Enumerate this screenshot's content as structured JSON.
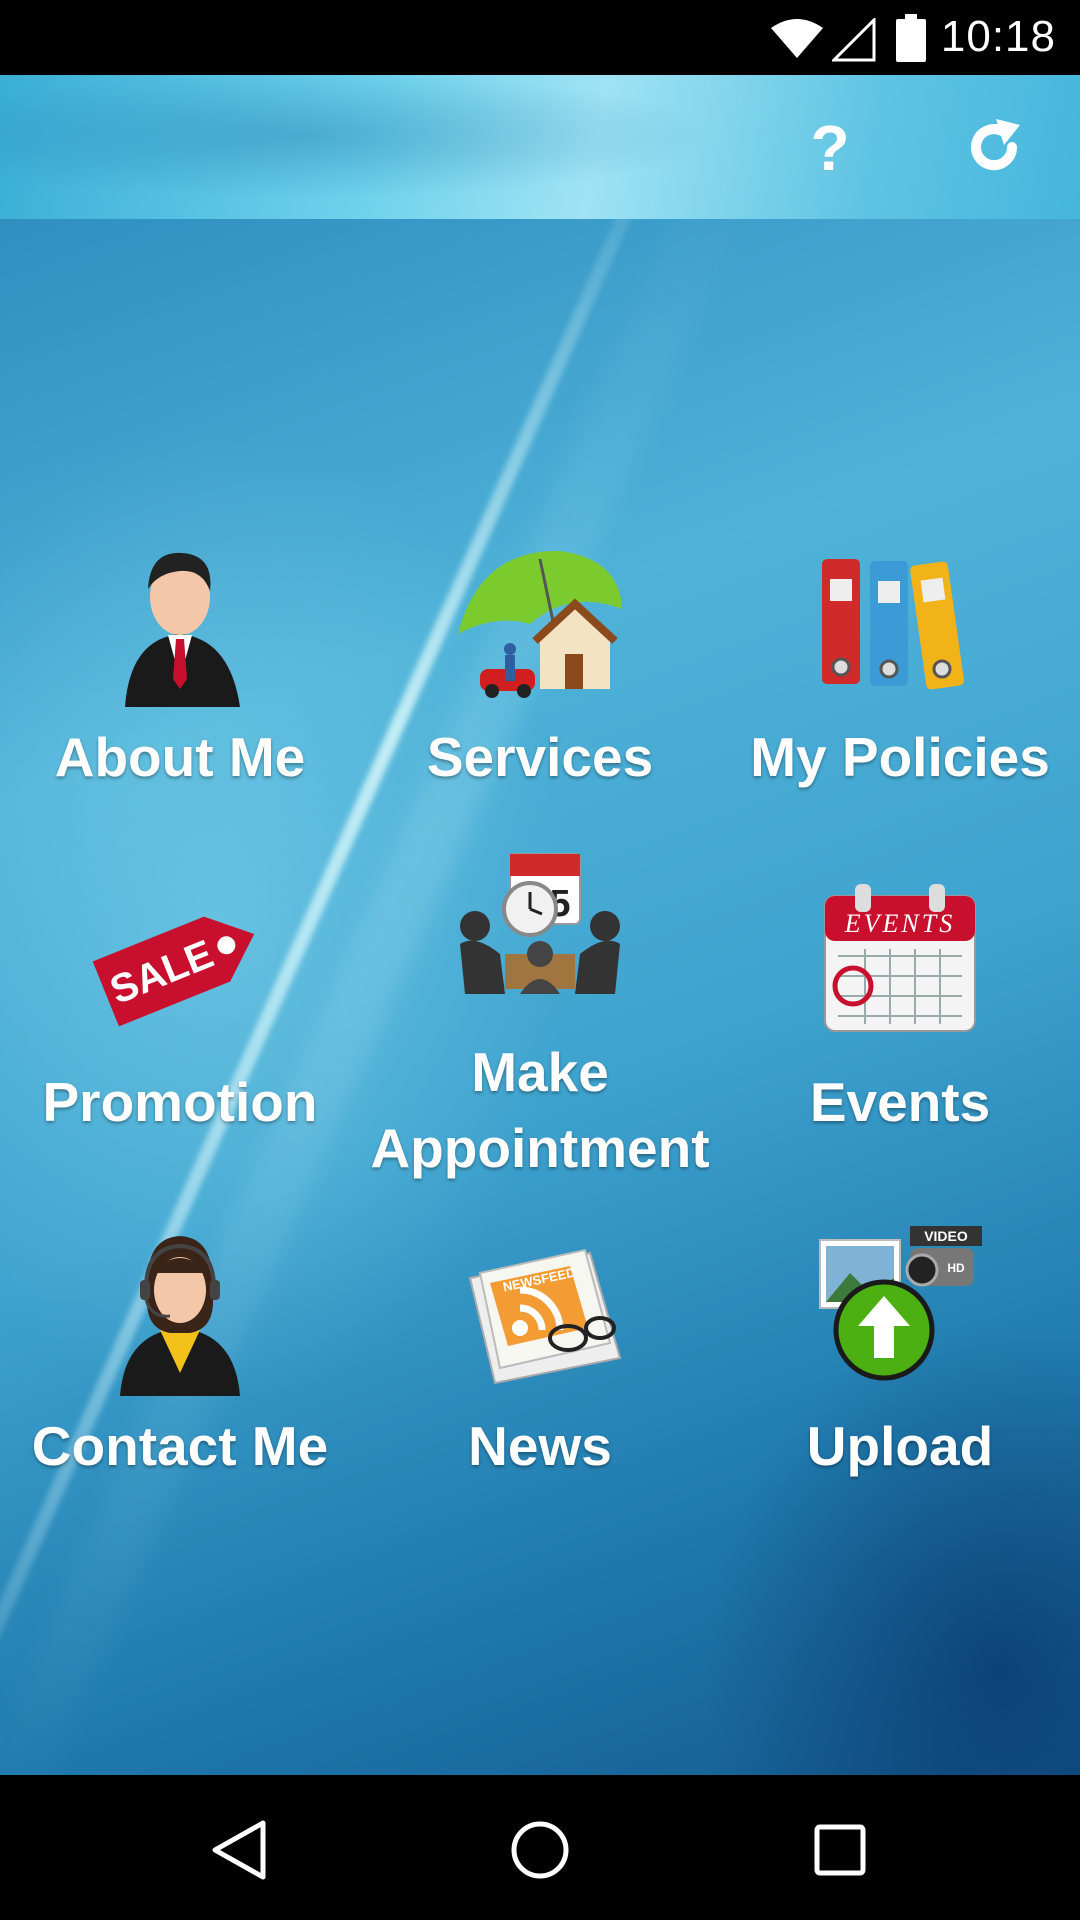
{
  "status_bar": {
    "time": "10:18",
    "icons": [
      "wifi-icon",
      "cell-signal-icon",
      "battery-icon"
    ]
  },
  "header": {
    "help_label": "?",
    "actions": [
      "help-icon",
      "refresh-icon"
    ]
  },
  "menu": {
    "items": [
      {
        "label": "About Me",
        "icon": "businessman-icon"
      },
      {
        "label": "Services",
        "icon": "umbrella-house-car-icon"
      },
      {
        "label": "My Policies",
        "icon": "binders-icon"
      },
      {
        "label": "Promotion",
        "icon": "sale-tag-icon"
      },
      {
        "label_line1": "Make",
        "label_line2": "Appointment",
        "icon": "meeting-clock-calendar-icon"
      },
      {
        "label": "Events",
        "icon": "events-calendar-icon",
        "icon_text": "EVENTS"
      },
      {
        "label": "Contact Me",
        "icon": "support-agent-icon"
      },
      {
        "label": "News",
        "icon": "newspaper-icon",
        "icon_text": "NEWSFEED"
      },
      {
        "label": "Upload",
        "icon": "upload-media-icon",
        "icon_text": "VIDEO"
      }
    ]
  },
  "sale_tag_text": "SALE",
  "calendar_day": "5",
  "camera_badge": "HD",
  "nav": {
    "buttons": [
      "back-icon",
      "home-icon",
      "recents-icon"
    ]
  },
  "colors": {
    "header": "#6fd2ec",
    "background": "#3ea3cf",
    "label": "#ffffff"
  }
}
